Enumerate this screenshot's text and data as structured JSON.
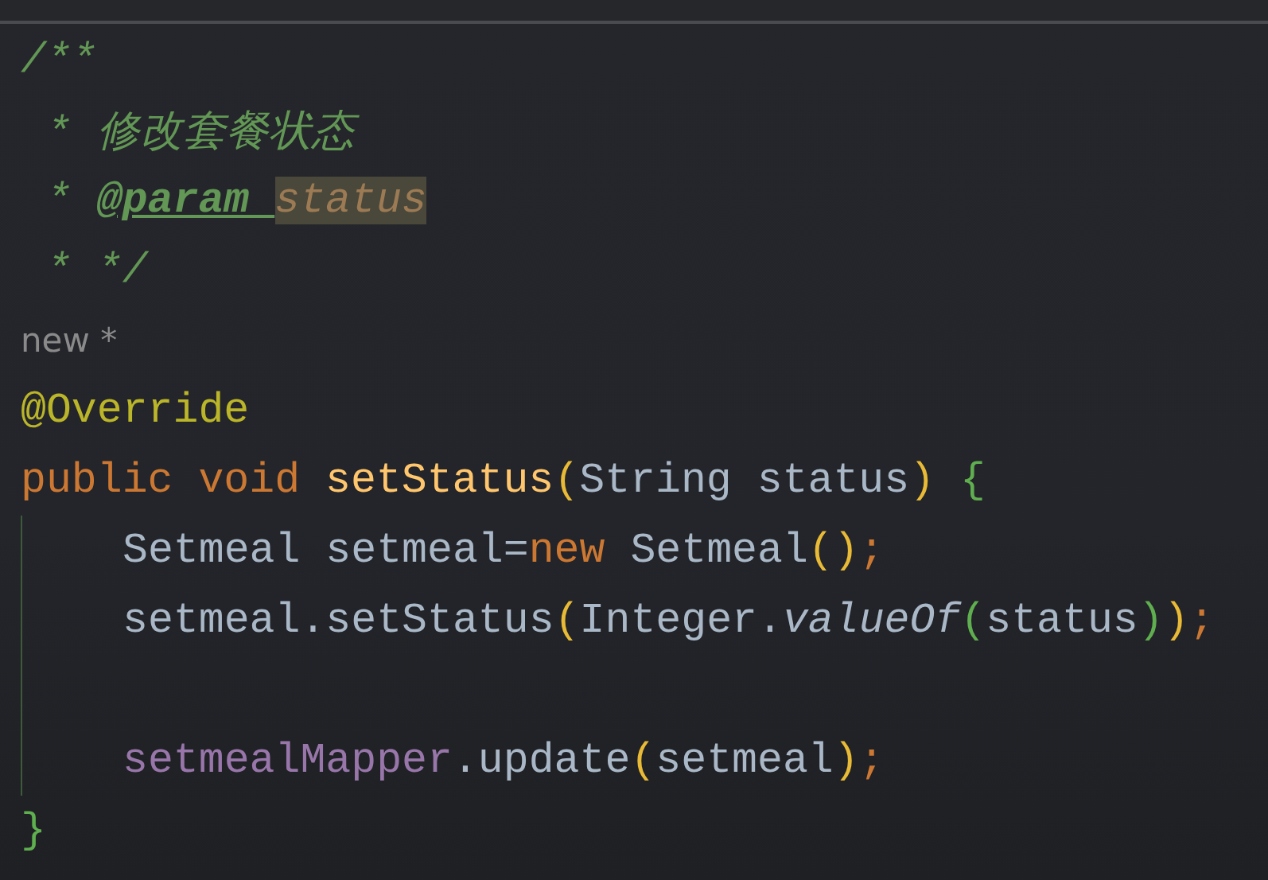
{
  "editor": {
    "lines": [
      {
        "kind": "code",
        "indented": false,
        "tokens": [
          {
            "kind": "comment",
            "text": "/**"
          }
        ]
      },
      {
        "kind": "code",
        "indented": false,
        "tokens": [
          {
            "kind": "comment",
            "text": " * 修改套餐状态"
          }
        ]
      },
      {
        "kind": "code",
        "indented": false,
        "tokens": [
          {
            "kind": "comment",
            "text": " * "
          },
          {
            "kind": "doc-tag",
            "text": "@param "
          },
          {
            "kind": "doc-param",
            "text": "status",
            "highlighted": true
          }
        ]
      },
      {
        "kind": "code",
        "indented": false,
        "tokens": [
          {
            "kind": "comment",
            "text": " * */"
          }
        ]
      },
      {
        "kind": "hint",
        "text": "new *"
      },
      {
        "kind": "code",
        "indented": false,
        "tokens": [
          {
            "kind": "annotation",
            "text": "@Override"
          }
        ]
      },
      {
        "kind": "code",
        "indented": false,
        "tokens": [
          {
            "kind": "keyword",
            "text": "public void "
          },
          {
            "kind": "method-decl",
            "text": "setStatus"
          },
          {
            "kind": "bracket1",
            "text": "("
          },
          {
            "kind": "plain",
            "text": "String status"
          },
          {
            "kind": "bracket1",
            "text": ")"
          },
          {
            "kind": "bracket2",
            "text": " {"
          }
        ]
      },
      {
        "kind": "code",
        "indented": true,
        "tokens": [
          {
            "kind": "plain",
            "text": "Setmeal setmeal="
          },
          {
            "kind": "keyword",
            "text": "new "
          },
          {
            "kind": "plain",
            "text": "Setmeal"
          },
          {
            "kind": "bracket1",
            "text": "()"
          },
          {
            "kind": "keyword",
            "text": ";"
          }
        ]
      },
      {
        "kind": "code",
        "indented": true,
        "tokens": [
          {
            "kind": "plain",
            "text": "setmeal.setStatus"
          },
          {
            "kind": "bracket1",
            "text": "("
          },
          {
            "kind": "plain",
            "text": "Integer."
          },
          {
            "kind": "static-method",
            "text": "valueOf"
          },
          {
            "kind": "bracket2",
            "text": "("
          },
          {
            "kind": "plain",
            "text": "status"
          },
          {
            "kind": "bracket2",
            "text": ")"
          },
          {
            "kind": "bracket1",
            "text": ")"
          },
          {
            "kind": "keyword",
            "text": ";"
          }
        ]
      },
      {
        "kind": "code",
        "indented": true
      },
      {
        "kind": "code",
        "indented": true,
        "tokens": [
          {
            "kind": "field",
            "text": "setmealMapper"
          },
          {
            "kind": "plain",
            "text": ".update"
          },
          {
            "kind": "bracket1",
            "text": "("
          },
          {
            "kind": "plain",
            "text": "setmeal"
          },
          {
            "kind": "bracket1",
            "text": ")"
          },
          {
            "kind": "keyword",
            "text": ";"
          }
        ]
      },
      {
        "kind": "code",
        "indented": false,
        "tokens": [
          {
            "kind": "bracket2",
            "text": "}"
          }
        ]
      }
    ]
  }
}
